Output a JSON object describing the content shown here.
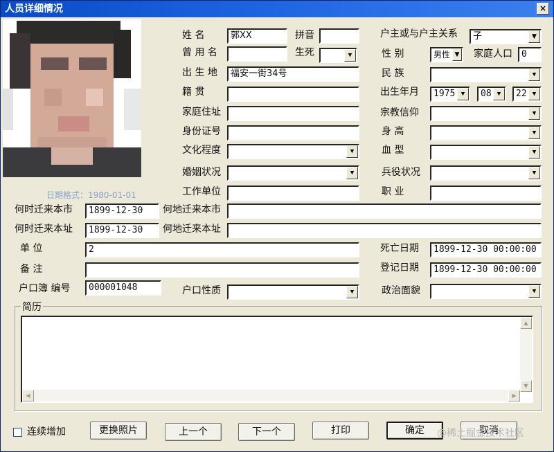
{
  "window": {
    "title": "人员详细情况",
    "close": "×"
  },
  "hint": "日期格式：1980-01-01",
  "labels": {
    "name": "姓    名",
    "pinyin": "拼音",
    "used_name": "曾 用 名",
    "alive": "生死",
    "birthplace": "出 生 地",
    "native": "籍    贯",
    "address": "家庭住址",
    "id_no": "身份证号",
    "education": "文化程度",
    "marriage": "婚姻状况",
    "workplace": "工作单位",
    "relation": "户主或与户主关系",
    "gender": "性    别",
    "family_count": "家庭人口",
    "ethnicity": "民    族",
    "birth": "出生年月",
    "religion": "宗教信仰",
    "height": "身    高",
    "blood": "血    型",
    "military": "兵役状况",
    "occupation": "职    业",
    "move_city_date": "何时迁来本市",
    "move_city_from": "何地迁来本市",
    "move_addr_date": "何时迁来本址",
    "move_addr_from": "何地迁来本址",
    "unit": "单       位",
    "death_date": "死亡日期",
    "note": "备       注",
    "register_date": "登记日期",
    "household_no": "户口簿 编号",
    "household_type": "户口性质",
    "political": "政治面貌",
    "resume": "简历"
  },
  "values": {
    "name": "郭XX",
    "pinyin": "",
    "used_name": "",
    "alive": "",
    "birthplace": "福安一街34号",
    "native": "",
    "address": "",
    "id_no": "",
    "education": "",
    "marriage": "",
    "workplace": "",
    "relation": "子",
    "gender": "男性",
    "family_count": "0",
    "ethnicity": "",
    "birth_year": "1975",
    "birth_month": "08",
    "birth_day": "22",
    "religion": "",
    "height": "",
    "blood": "",
    "military": "",
    "occupation": "",
    "move_city_date": "1899-12-30",
    "move_city_from": "",
    "move_addr_date": "1899-12-30",
    "move_addr_from": "",
    "unit": "2",
    "death_date": "1899-12-30 00:00:00",
    "note": "",
    "register_date": "1899-12-30 00:00:00",
    "household_no": "000001048",
    "household_type": "",
    "political": "",
    "resume": ""
  },
  "buttons": {
    "continuous_add": "连续增加",
    "change_photo": "更换照片",
    "prev": "上一个",
    "next": "下一个",
    "print": "打印",
    "ok": "确定",
    "cancel": "取消"
  },
  "watermark": "@稀土掘金技术社区",
  "icons": {
    "dropdown": "chevron-down-icon",
    "close": "close-icon"
  }
}
